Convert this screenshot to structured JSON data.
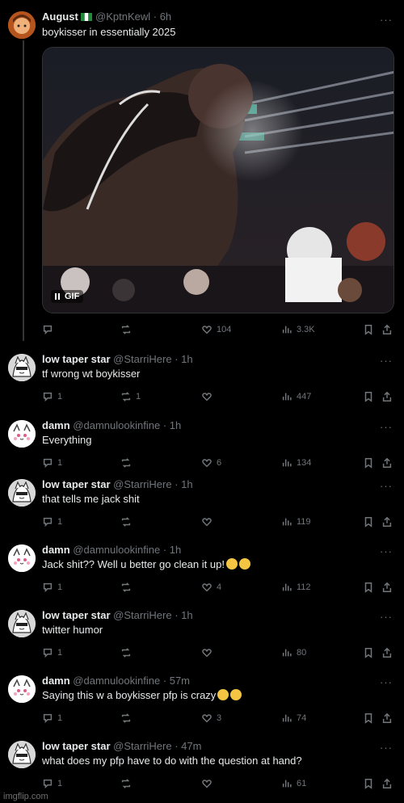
{
  "thread": {
    "root": {
      "name": "August",
      "flag": "🇳🇬",
      "handle": "@KptnKewl · 6h",
      "text": "boykisser in essentially 2025",
      "gif_label": "GIF",
      "stats": {
        "likes": "104",
        "views": "3.3K"
      }
    },
    "replies": [
      {
        "name": "low taper star",
        "handle": "@StarriHere · 1h",
        "text": "tf wrong wt boykisser",
        "replies": "1",
        "reposts": "1",
        "likes": "",
        "views": "447"
      },
      {
        "name": "damn",
        "handle": "@damnulookinfine · 1h",
        "text": "Everything",
        "replies": "1",
        "reposts": "",
        "likes": "6",
        "views": "134"
      },
      {
        "name": "low taper star",
        "handle": "@StarriHere · 1h",
        "text": "that tells me jack shit",
        "replies": "1",
        "reposts": "",
        "likes": "",
        "views": "119"
      },
      {
        "name": "damn",
        "handle": "@damnulookinfine · 1h",
        "text": "Jack shit?? Well u better go clean it up!",
        "replies": "1",
        "reposts": "",
        "likes": "4",
        "views": "112"
      },
      {
        "name": "low taper star",
        "handle": "@StarriHere · 1h",
        "text": "twitter humor",
        "replies": "1",
        "reposts": "",
        "likes": "",
        "views": "80"
      },
      {
        "name": "damn",
        "handle": "@damnulookinfine · 57m",
        "text": "Saying this w a boykisser pfp is crazy",
        "replies": "1",
        "reposts": "",
        "likes": "3",
        "views": "74"
      },
      {
        "name": "low taper star",
        "handle": "@StarriHere · 47m",
        "text": "what does my pfp have to do with the question at hand?",
        "replies": "1",
        "reposts": "",
        "likes": "",
        "views": "61"
      }
    ]
  },
  "footer": "imgflip.com",
  "colors": {
    "background": "#000000",
    "text": "#e7e9ea",
    "muted": "#71767b",
    "thread_line": "#333639"
  }
}
